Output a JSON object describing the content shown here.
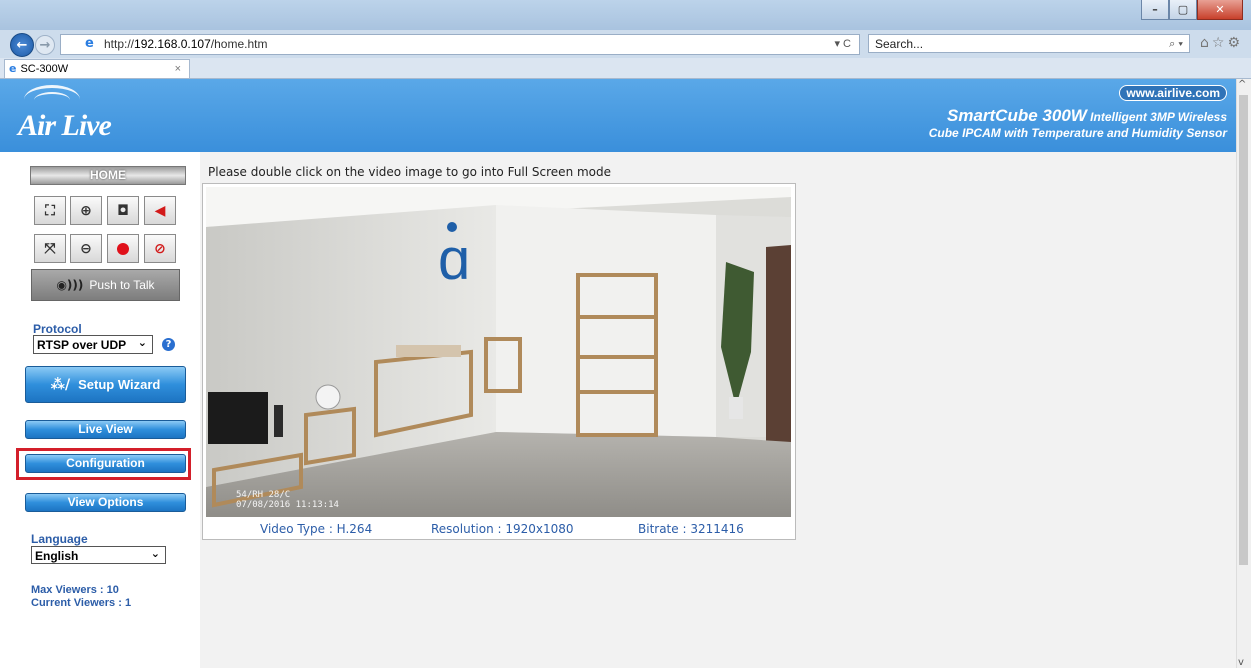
{
  "browser": {
    "url_prefix": "http://",
    "url_host": "192.168.0.107",
    "url_path": "/home.htm",
    "search_placeholder": "Search...",
    "tab_title": "SC-300W",
    "refresh_glyph": "▾ C",
    "search_glyph": "⌕ ▾",
    "toolbar_glyphs": "⌂☆⚙"
  },
  "header": {
    "brand": "Air Live",
    "website": "www.airlive.com",
    "product_name": "SmartCube 300W",
    "product_tagline1": "Intelligent 3MP Wireless",
    "product_tagline2": "Cube IPCAM with Temperature and Humidity Sensor"
  },
  "sidebar": {
    "home_label": "HOME",
    "push_to_talk": "Push to Talk",
    "protocol_label": "Protocol",
    "protocol_value": "RTSP over UDP",
    "setup_wizard": "Setup Wizard",
    "live_view": "Live View",
    "configuration": "Configuration",
    "view_options": "View Options",
    "language_label": "Language",
    "language_value": "English",
    "max_viewers": "Max Viewers : 10",
    "current_viewers": "Current Viewers : 1"
  },
  "main": {
    "hint": "Please double click on the video image to go into Full Screen mode",
    "video_type": "Video Type : H.264",
    "resolution": "Resolution : 1920x1080",
    "bitrate": "Bitrate : 3211416",
    "overlay_line1": "54/RH  28/C",
    "overlay_line2": "07/08/2016  11:13:14"
  },
  "colors": {
    "banner": "#3a8fdb",
    "accent_blue": "#2c5da8",
    "highlight_red": "#d31f2a"
  }
}
